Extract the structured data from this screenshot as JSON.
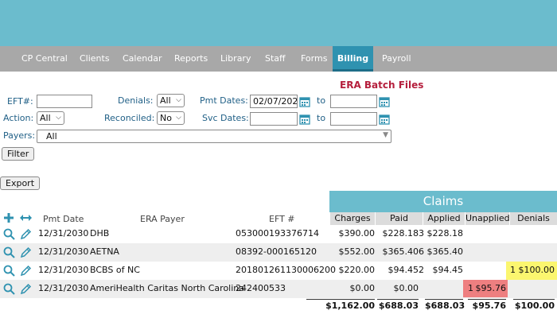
{
  "nav": {
    "items": [
      {
        "label": "CP Central"
      },
      {
        "label": "Clients"
      },
      {
        "label": "Calendar"
      },
      {
        "label": "Reports"
      },
      {
        "label": "Library"
      },
      {
        "label": "Staff"
      },
      {
        "label": "Forms"
      },
      {
        "label": "Billing"
      },
      {
        "label": "Payroll"
      }
    ],
    "active": "Billing"
  },
  "page_title": "ERA Batch Files",
  "filters": {
    "eft_label": "EFT#:",
    "eft_value": "",
    "denials_label": "Denials:",
    "denials_value": "All",
    "pmt_dates_label": "Pmt Dates:",
    "pmt_from": "02/07/202",
    "to_label": "to",
    "pmt_to": "",
    "action_label": "Action:",
    "action_value": "All",
    "reconciled_label": "Reconciled:",
    "reconciled_value": "No",
    "svc_dates_label": "Svc Dates:",
    "svc_from": "",
    "svc_to": "",
    "payers_label": "Payers:",
    "payers_value": "All",
    "filter_button": "Filter",
    "export_button": "Export"
  },
  "table": {
    "claims_header": "Claims",
    "columns": {
      "pmt_date": "Pmt Date",
      "era_payer": "ERA Payer",
      "eft": "EFT #",
      "charges": "Charges",
      "paid": "Paid",
      "applied": "Applied",
      "unapplied": "Unapplied",
      "denials": "Denials"
    },
    "rows": [
      {
        "date": "12/31/2030",
        "payer": "DHB",
        "eft": "053000193376714",
        "charges": "$390.00",
        "paid": "$228.18",
        "applied_count": "3",
        "applied": "$228.18",
        "unapplied_count": "",
        "unapplied": "",
        "denials_count": "",
        "denials": ""
      },
      {
        "date": "12/31/2030",
        "payer": "AETNA",
        "eft": "08392-000165120",
        "charges": "$552.00",
        "paid": "$365.40",
        "applied_count": "6",
        "applied": "$365.40",
        "unapplied_count": "",
        "unapplied": "",
        "denials_count": "",
        "denials": ""
      },
      {
        "date": "12/31/2030",
        "payer": "BCBS of NC",
        "eft": "201801261130006200",
        "charges": "$220.00",
        "paid": "$94.45",
        "applied_count": "2",
        "applied": "$94.45",
        "unapplied_count": "",
        "unapplied": "",
        "denials_count": "1",
        "denials": "$100.00"
      },
      {
        "date": "12/31/2030",
        "payer": "AmeriHealth Caritas North Carolina",
        "eft": "242400533",
        "charges": "$0.00",
        "paid": "$0.00",
        "applied_count": "",
        "applied": "",
        "unapplied_count": "1",
        "unapplied": "$95.76",
        "denials_count": "",
        "denials": ""
      }
    ],
    "totals": {
      "charges": "$1,162.00",
      "paid": "$688.03",
      "applied": "$688.03",
      "unapplied": "$95.76",
      "denials": "$100.00"
    }
  },
  "colors": {
    "banner": "#6bbccd",
    "nav": "#a8a8a8",
    "active_tab": "#2f92b0",
    "title": "#b51e3c",
    "label": "#1f5f86",
    "denial_highlight": "#fbf66f",
    "unapplied_highlight": "#ee7f80"
  }
}
